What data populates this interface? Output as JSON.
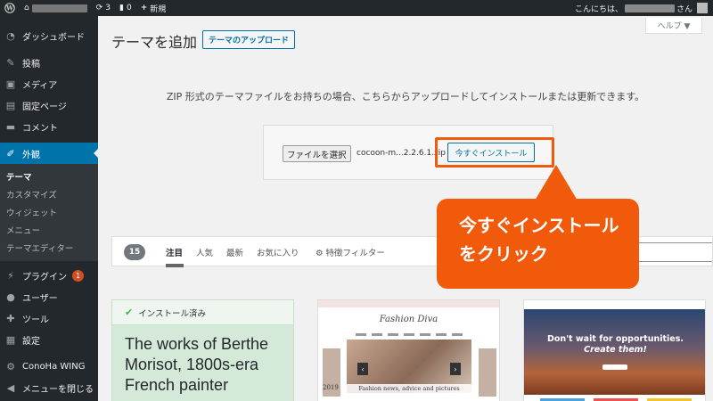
{
  "adminbar": {
    "updates_count": "3",
    "comments_count": "0",
    "new_label": "新規",
    "greeting": "こんにちは、",
    "greeting_suffix": "さん"
  },
  "sidebar": {
    "items": [
      {
        "label": "ダッシュボード",
        "icon": "dashboard-icon"
      },
      {
        "label": "投稿",
        "icon": "pin-icon"
      },
      {
        "label": "メディア",
        "icon": "media-icon"
      },
      {
        "label": "固定ページ",
        "icon": "page-icon"
      },
      {
        "label": "コメント",
        "icon": "comment-icon"
      },
      {
        "label": "外観",
        "icon": "brush-icon"
      }
    ],
    "submenu": [
      "テーマ",
      "カスタマイズ",
      "ウィジェット",
      "メニュー",
      "テーマエディター"
    ],
    "items2": [
      {
        "label": "プラグイン",
        "icon": "plug-icon",
        "badge": "1"
      },
      {
        "label": "ユーザー",
        "icon": "user-icon"
      },
      {
        "label": "ツール",
        "icon": "wrench-icon"
      },
      {
        "label": "設定",
        "icon": "settings-icon"
      },
      {
        "label": "ConoHa WING",
        "icon": "gear-icon"
      },
      {
        "label": "メニューを閉じる",
        "icon": "collapse-icon"
      }
    ]
  },
  "header": {
    "title": "テーマを追加",
    "upload_button": "テーマのアップロード",
    "help": "ヘルプ ▼"
  },
  "upload": {
    "description": "ZIP 形式のテーマファイルをお持ちの場合、こちらからアップロードしてインストールまたは更新できます。",
    "choose_file": "ファイルを選択",
    "file_name": "cocoon-m...2.2.6.1.zip",
    "install_button": "今すぐインストール"
  },
  "callout": {
    "line1": "今すぐインストール",
    "line2": "をクリック"
  },
  "filter": {
    "count": "15",
    "tabs": [
      "注目",
      "人気",
      "最新",
      "お気に入り"
    ],
    "feature_filter": "特徴フィルター"
  },
  "cards": {
    "installed_label": "インストール済み",
    "card1_title": "The works of Berthe Morisot, 1800s-era French painter",
    "card2_logo": "Fashion Diva",
    "card2_caption": "Fashion news, advice and pictures",
    "card2_year": "2019",
    "card3_line1": "Don't wait for opportunities.",
    "card3_line2": "Create them!"
  },
  "colors": {
    "admin_bg": "#23282d",
    "accent_blue": "#0073aa",
    "callout_orange": "#f15a0b",
    "installed_green": "#46b450"
  }
}
